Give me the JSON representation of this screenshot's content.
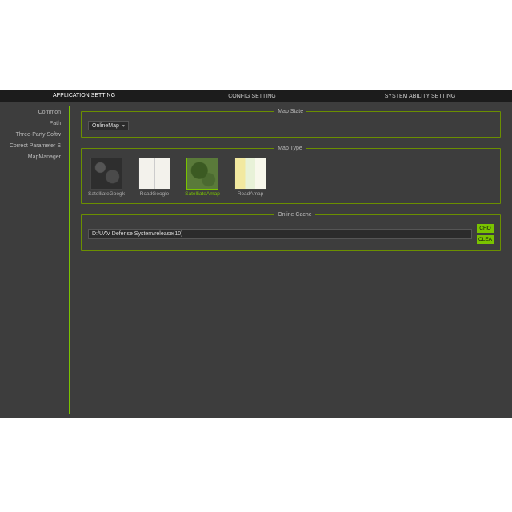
{
  "tabs": {
    "application": "APPLICATION SETTING",
    "config": "CONFIG SETTING",
    "system": "SYSTEM ABILITY SETTING"
  },
  "sidebar": {
    "items": [
      "Common",
      "Path",
      "Three-Party Softw",
      "Correct Parameter S",
      "MapManager"
    ]
  },
  "groups": {
    "mapstate": {
      "legend": "Map State",
      "select_value": "OnlineMap"
    },
    "maptype": {
      "legend": "Map Type",
      "options": [
        {
          "label": "SatelliateGoogle"
        },
        {
          "label": "RoadGoogle"
        },
        {
          "label": "SatelliateAmap"
        },
        {
          "label": "RoadAmap"
        }
      ],
      "selected_index": 2
    },
    "cache": {
      "legend": "Online Cache",
      "path": "D:/UAV Defense System/release(10)",
      "choose_label": "CHO",
      "clear_label": "CLEA"
    }
  }
}
